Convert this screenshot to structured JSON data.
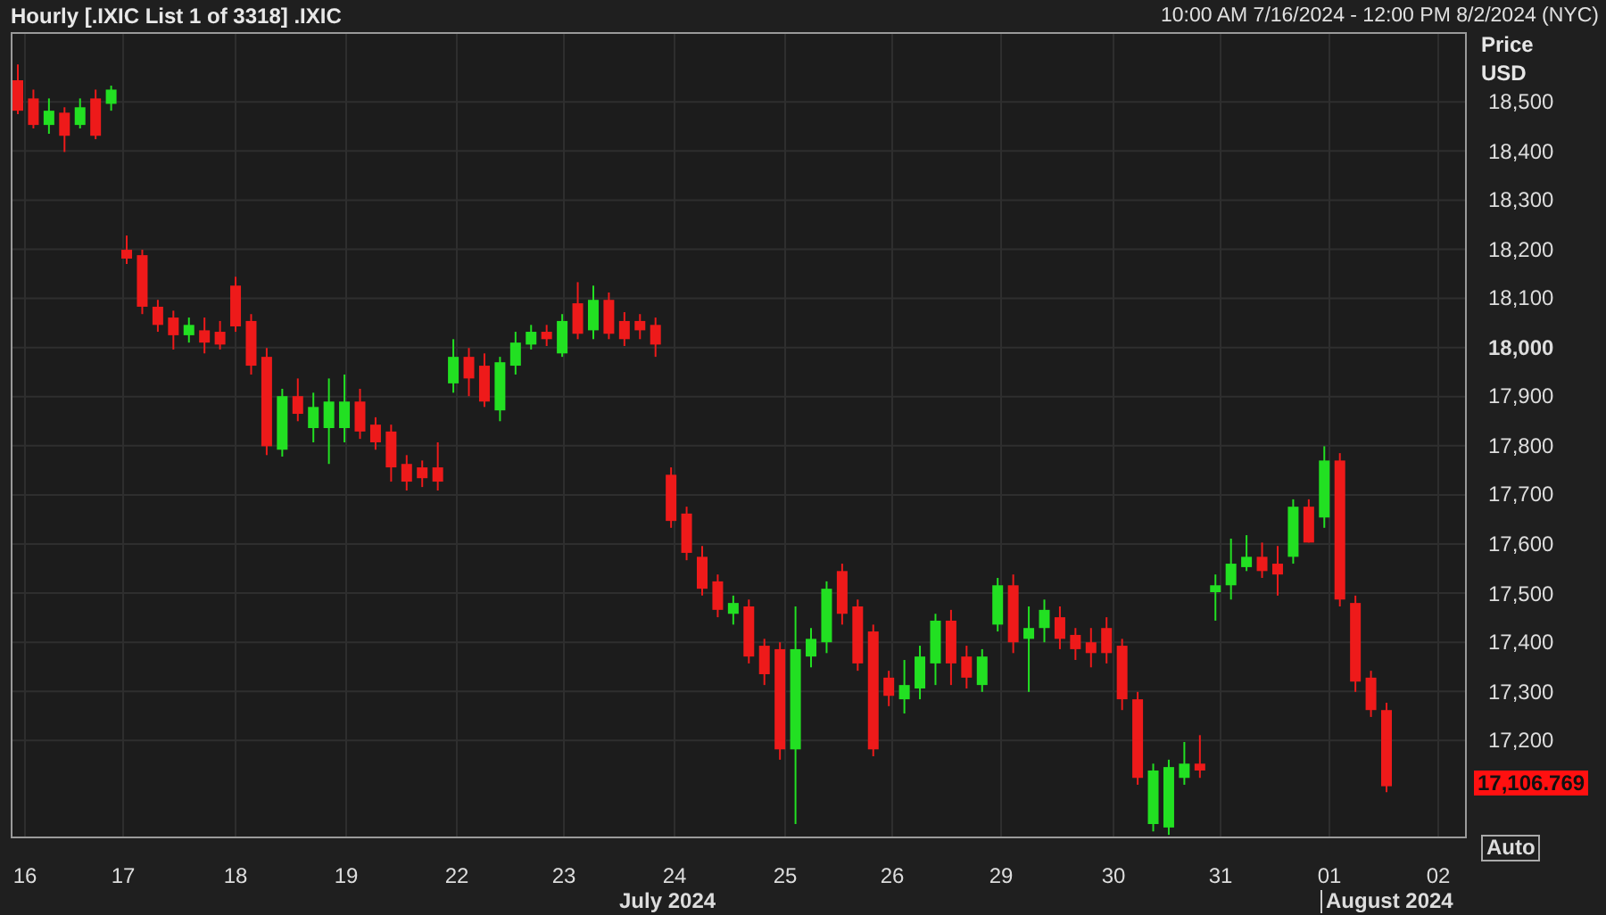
{
  "header": {
    "title": "Hourly [.IXIC List 1 of 3318] .IXIC",
    "range": "10:00 AM 7/16/2024 - 12:00 PM 8/2/2024 (NYC)"
  },
  "chart": {
    "chart_data": {
      "type": "candlestick",
      "ylim": [
        17001,
        18642
      ],
      "yticks": [
        {
          "value": 18500,
          "label": "18,500"
        },
        {
          "value": 18400,
          "label": "18,400"
        },
        {
          "value": 18300,
          "label": "18,300"
        },
        {
          "value": 18200,
          "label": "18,200"
        },
        {
          "value": 18100,
          "label": "18,100"
        },
        {
          "value": 18000,
          "label": "18,000"
        },
        {
          "value": 17900,
          "label": "17,900"
        },
        {
          "value": 17800,
          "label": "17,800"
        },
        {
          "value": 17700,
          "label": "17,700"
        },
        {
          "value": 17600,
          "label": "17,600"
        },
        {
          "value": 17500,
          "label": "17,500"
        },
        {
          "value": 17400,
          "label": "17,400"
        },
        {
          "value": 17300,
          "label": "17,300"
        },
        {
          "value": 17200,
          "label": "17,200"
        }
      ],
      "grid": true,
      "categories": [
        null,
        null,
        null,
        null,
        null,
        null,
        null,
        null,
        null,
        null,
        null,
        null,
        null,
        null,
        null,
        null,
        null,
        null,
        null,
        null,
        null,
        null,
        null,
        null,
        null,
        null,
        null,
        null,
        null,
        null,
        null,
        null,
        null,
        null,
        null,
        null,
        null,
        null,
        null,
        null,
        null,
        null,
        null,
        null,
        null,
        null,
        null,
        null,
        null,
        null,
        null,
        null,
        null,
        null,
        null,
        null,
        null,
        null,
        null,
        null,
        null,
        null,
        null,
        null,
        null,
        null,
        null,
        null,
        null,
        null,
        null,
        null,
        null,
        null,
        null,
        null,
        null,
        null,
        null,
        null,
        null,
        null,
        null,
        null,
        null,
        null,
        null,
        null,
        null
      ],
      "ohlc": [
        [
          18544,
          18576,
          18475,
          18482
        ],
        [
          18507,
          18525,
          18446,
          18453
        ],
        [
          18453,
          18507,
          18435,
          18482
        ],
        [
          18478,
          18489,
          18398,
          18431
        ],
        [
          18453,
          18507,
          18446,
          18489
        ],
        [
          18507,
          18525,
          18424,
          18431
        ],
        [
          18496,
          18533,
          18482,
          18525
        ],
        [
          18199,
          18228,
          18170,
          18181
        ],
        [
          18188,
          18199,
          18068,
          18083
        ],
        [
          18083,
          18097,
          18032,
          18046
        ],
        [
          18061,
          18075,
          17996,
          18025
        ],
        [
          18025,
          18061,
          18010,
          18046
        ],
        [
          18035,
          18061,
          17988,
          18010
        ],
        [
          18032,
          18054,
          17996,
          18006
        ],
        [
          18126,
          18144,
          18032,
          18043
        ],
        [
          18054,
          18068,
          17945,
          17963
        ],
        [
          17981,
          17999,
          17781,
          17799
        ],
        [
          17792,
          17916,
          17778,
          17901
        ],
        [
          17901,
          17937,
          17850,
          17865
        ],
        [
          17836,
          17908,
          17807,
          17879
        ],
        [
          17836,
          17937,
          17763,
          17890
        ],
        [
          17836,
          17945,
          17807,
          17890
        ],
        [
          17890,
          17916,
          17814,
          17829
        ],
        [
          17843,
          17858,
          17792,
          17807
        ],
        [
          17829,
          17843,
          17727,
          17756
        ],
        [
          17763,
          17781,
          17709,
          17727
        ],
        [
          17756,
          17770,
          17716,
          17734
        ],
        [
          17756,
          17807,
          17709,
          17727
        ],
        [
          17927,
          18017,
          17908,
          17981
        ],
        [
          17981,
          17999,
          17901,
          17937
        ],
        [
          17963,
          17988,
          17879,
          17890
        ],
        [
          17872,
          17981,
          17850,
          17970
        ],
        [
          17963,
          18032,
          17945,
          18010
        ],
        [
          18006,
          18046,
          17996,
          18032
        ],
        [
          18032,
          18046,
          18003,
          18017
        ],
        [
          17988,
          18068,
          17981,
          18054
        ],
        [
          18090,
          18133,
          18017,
          18028
        ],
        [
          18035,
          18126,
          18017,
          18097
        ],
        [
          18097,
          18112,
          18017,
          18028
        ],
        [
          18054,
          18072,
          18003,
          18017
        ],
        [
          18054,
          18068,
          18017,
          18035
        ],
        [
          18046,
          18061,
          17981,
          18006
        ],
        [
          17741,
          17756,
          17633,
          17647
        ],
        [
          17662,
          17676,
          17567,
          17582
        ],
        [
          17574,
          17596,
          17495,
          17509
        ],
        [
          17524,
          17538,
          17451,
          17466
        ],
        [
          17458,
          17495,
          17436,
          17480
        ],
        [
          17473,
          17487,
          17357,
          17371
        ],
        [
          17393,
          17407,
          17313,
          17335
        ],
        [
          17386,
          17400,
          17161,
          17182
        ],
        [
          17182,
          17473,
          17030,
          17386
        ],
        [
          17371,
          17429,
          17349,
          17407
        ],
        [
          17400,
          17524,
          17378,
          17509
        ],
        [
          17545,
          17560,
          17436,
          17458
        ],
        [
          17473,
          17487,
          17342,
          17357
        ],
        [
          17422,
          17436,
          17168,
          17182
        ],
        [
          17328,
          17342,
          17270,
          17291
        ],
        [
          17284,
          17364,
          17255,
          17313
        ],
        [
          17306,
          17393,
          17284,
          17371
        ],
        [
          17357,
          17458,
          17313,
          17444
        ],
        [
          17444,
          17466,
          17313,
          17357
        ],
        [
          17371,
          17393,
          17306,
          17328
        ],
        [
          17313,
          17386,
          17299,
          17371
        ],
        [
          17436,
          17531,
          17422,
          17516
        ],
        [
          17516,
          17538,
          17378,
          17400
        ],
        [
          17407,
          17473,
          17299,
          17429
        ],
        [
          17429,
          17487,
          17400,
          17466
        ],
        [
          17451,
          17473,
          17386,
          17407
        ],
        [
          17415,
          17429,
          17364,
          17386
        ],
        [
          17400,
          17429,
          17349,
          17378
        ],
        [
          17429,
          17451,
          17357,
          17378
        ],
        [
          17393,
          17407,
          17262,
          17284
        ],
        [
          17284,
          17299,
          17110,
          17124
        ],
        [
          17030,
          17153,
          17015,
          17139
        ],
        [
          17023,
          17161,
          17008,
          17146
        ],
        [
          17124,
          17197,
          17110,
          17153
        ],
        [
          17153,
          17211,
          17124,
          17139
        ],
        [
          17502,
          17538,
          17444,
          17516
        ],
        [
          17516,
          17611,
          17487,
          17560
        ],
        [
          17553,
          17618,
          17545,
          17574
        ],
        [
          17574,
          17603,
          17531,
          17545
        ],
        [
          17560,
          17596,
          17495,
          17538
        ],
        [
          17574,
          17691,
          17560,
          17676
        ],
        [
          17676,
          17691,
          17603,
          17603
        ],
        [
          17654,
          17799,
          17633,
          17770
        ],
        [
          17770,
          17785,
          17473,
          17487
        ],
        [
          17480,
          17495,
          17299,
          17320
        ],
        [
          17328,
          17342,
          17248,
          17262
        ],
        [
          17262,
          17277,
          17095,
          17107
        ]
      ]
    }
  },
  "price_axis": {
    "title": "Price",
    "unit": "USD",
    "tick_styles": [
      {
        "major": false
      },
      {
        "major": false
      },
      {
        "major": false
      },
      {
        "major": false
      },
      {
        "major": false
      },
      {
        "major": true
      },
      {
        "major": false
      },
      {
        "major": false
      },
      {
        "major": false
      },
      {
        "major": false
      },
      {
        "major": false
      },
      {
        "major": false
      },
      {
        "major": false
      },
      {
        "major": false
      }
    ],
    "last_price": "17,106.769",
    "scale_button": "Auto"
  },
  "time_axis": {
    "days": [
      "16",
      "17",
      "18",
      "19",
      "22",
      "23",
      "24",
      "25",
      "26",
      "29",
      "30",
      "31",
      "01",
      "02"
    ],
    "months": [
      {
        "label": "July 2024",
        "boundary": false
      },
      {
        "label": "August 2024",
        "boundary": true
      }
    ]
  }
}
